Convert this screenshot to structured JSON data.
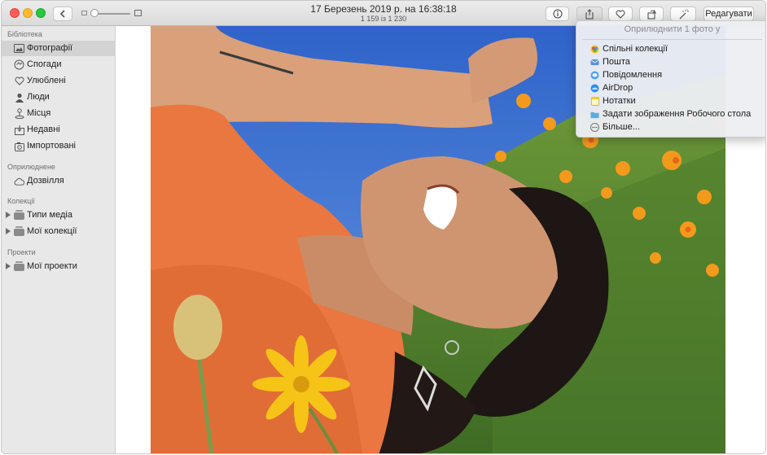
{
  "titlebar": {
    "title": "17 Березень 2019 р. на 16:38:18",
    "subtitle": "1 159 із 1 230",
    "edit_label": "Редагувати"
  },
  "sidebar": {
    "sections": [
      {
        "header": "Бібліотека",
        "items": [
          {
            "label": "Фотографії",
            "icon": "photos-icon",
            "selected": true
          },
          {
            "label": "Спогади",
            "icon": "memories-icon"
          },
          {
            "label": "Улюблені",
            "icon": "heart-icon"
          },
          {
            "label": "Люди",
            "icon": "people-icon"
          },
          {
            "label": "Місця",
            "icon": "places-icon"
          },
          {
            "label": "Недавні",
            "icon": "recent-icon"
          },
          {
            "label": "Імпортовані",
            "icon": "imported-icon"
          }
        ]
      },
      {
        "header": "Оприлюднене",
        "items": [
          {
            "label": "Дозвілля",
            "icon": "cloud-icon"
          }
        ]
      },
      {
        "header": "Колекції",
        "items": [
          {
            "label": "Типи медіа",
            "icon": "album-icon"
          },
          {
            "label": "Мої колекції",
            "icon": "album-icon"
          }
        ]
      },
      {
        "header": "Проекти",
        "items": [
          {
            "label": "Мої проекти",
            "icon": "album-icon"
          }
        ]
      }
    ]
  },
  "share_menu": {
    "header": "Оприлюднити 1 фото у",
    "items": [
      {
        "label": "Спільні колекції",
        "icon": "shared-albums-icon"
      },
      {
        "label": "Пошта",
        "icon": "mail-icon"
      },
      {
        "label": "Повідомлення",
        "icon": "messages-icon"
      },
      {
        "label": "AirDrop",
        "icon": "airdrop-icon"
      },
      {
        "label": "Нотатки",
        "icon": "notes-icon"
      },
      {
        "label": "Задати зображення Робочого стола",
        "icon": "desktop-folder-icon"
      },
      {
        "label": "Більше...",
        "icon": "more-icon"
      }
    ]
  },
  "colors": {
    "accent": "#2f6fd6",
    "sidebar_bg": "#e8e8e8",
    "selected_bg": "#d3d3d3",
    "sky": "#3a6ed0",
    "shirt": "#e9773f",
    "flowers": "#f39a1c"
  }
}
